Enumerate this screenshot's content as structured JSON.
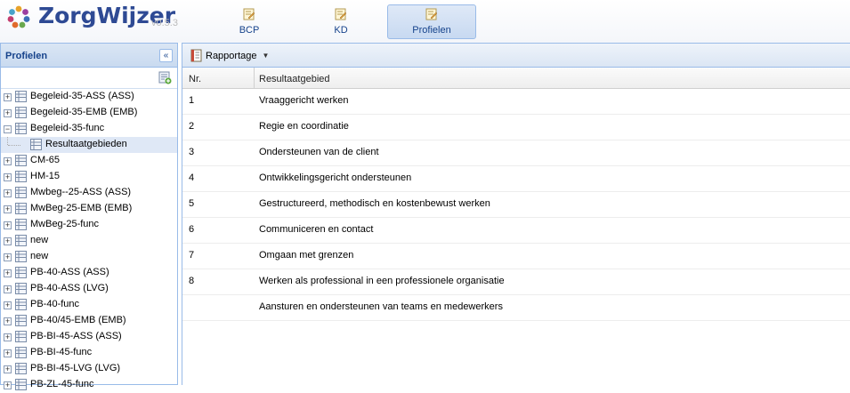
{
  "app": {
    "brand": "ZorgWijzer",
    "version": "v0.5.3",
    "logo_icon": "flower-logo-icon"
  },
  "nav": [
    {
      "label": "BCP",
      "icon": "edit-document-icon",
      "active": false
    },
    {
      "label": "KD",
      "icon": "edit-document-icon",
      "active": false
    },
    {
      "label": "Profielen",
      "icon": "edit-document-icon",
      "active": true
    }
  ],
  "left_panel": {
    "title": "Profielen",
    "collapse_icon": "double-chevron-left-icon",
    "toolbar_icon": "new-document-icon",
    "tree": [
      {
        "label": "Begeleid-35-ASS (ASS)",
        "expanded": false
      },
      {
        "label": "Begeleid-35-EMB (EMB)",
        "expanded": false
      },
      {
        "label": "Begeleid-35-func",
        "expanded": true,
        "children": [
          {
            "label": "Resultaatgebieden",
            "selected": true
          }
        ]
      },
      {
        "label": "CM-65",
        "expanded": false
      },
      {
        "label": "HM-15",
        "expanded": false
      },
      {
        "label": "Mwbeg--25-ASS (ASS)",
        "expanded": false
      },
      {
        "label": "MwBeg-25-EMB (EMB)",
        "expanded": false
      },
      {
        "label": "MwBeg-25-func",
        "expanded": false
      },
      {
        "label": "new",
        "expanded": false
      },
      {
        "label": "new",
        "expanded": false
      },
      {
        "label": "PB-40-ASS (ASS)",
        "expanded": false
      },
      {
        "label": "PB-40-ASS (LVG)",
        "expanded": false
      },
      {
        "label": "PB-40-func",
        "expanded": false
      },
      {
        "label": "PB-40/45-EMB (EMB)",
        "expanded": false
      },
      {
        "label": "PB-BI-45-ASS (ASS)",
        "expanded": false
      },
      {
        "label": "PB-BI-45-func",
        "expanded": false
      },
      {
        "label": "PB-BI-45-LVG (LVG)",
        "expanded": false
      },
      {
        "label": "PB-ZL-45-func",
        "expanded": false
      }
    ]
  },
  "right_panel": {
    "toolbar": {
      "rapportage_label": "Rapportage",
      "rapportage_icon": "report-icon",
      "dropdown_icon": "caret-down-icon"
    },
    "columns": [
      "Nr.",
      "Resultaatgebied"
    ],
    "rows": [
      {
        "nr": "1",
        "name": "Vraaggericht werken"
      },
      {
        "nr": "2",
        "name": "Regie en coordinatie"
      },
      {
        "nr": "3",
        "name": "Ondersteunen van de client"
      },
      {
        "nr": "4",
        "name": "Ontwikkelingsgericht ondersteunen"
      },
      {
        "nr": "5",
        "name": "Gestructureerd, methodisch en kostenbewust werken"
      },
      {
        "nr": "6",
        "name": "Communiceren en contact"
      },
      {
        "nr": "7",
        "name": "Omgaan met grenzen"
      },
      {
        "nr": "8",
        "name": "Werken als professional in een professionele organisatie"
      },
      {
        "nr": "",
        "name": "Aansturen en ondersteunen van teams en medewerkers"
      }
    ]
  }
}
